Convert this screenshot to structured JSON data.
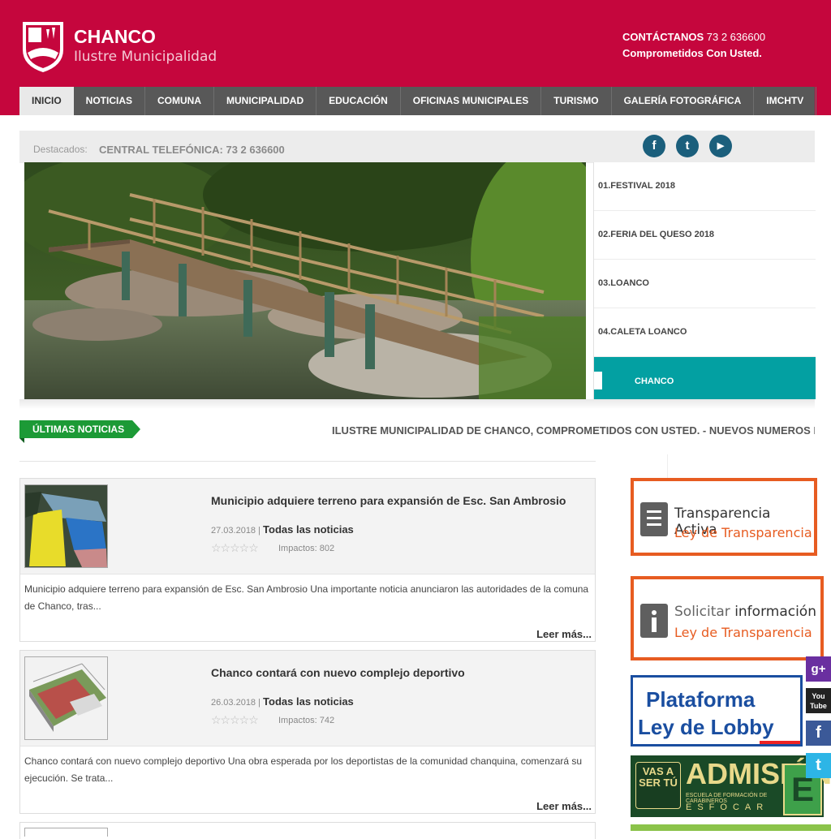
{
  "brand": {
    "title": "CHANCO",
    "subtitle": "Ilustre Municipalidad"
  },
  "contact": {
    "label": "CONTÁCTANOS",
    "phone": "73 2 636600",
    "tagline": "Comprometidos Con Usted."
  },
  "nav": {
    "items": [
      "INICIO",
      "NOTICIAS",
      "COMUNA",
      "MUNICIPALIDAD",
      "EDUCACIÓN",
      "OFICINAS MUNICIPALES",
      "TURISMO",
      "GALERÍA FOTOGRÁFICA",
      "IMCHTV"
    ]
  },
  "featured": {
    "label": "Destacados:",
    "text": "CENTRAL TELEFÓNICA: 73 2 636600"
  },
  "social": {
    "facebook": "f",
    "twitter": "t",
    "youtube": "▶"
  },
  "slider": {
    "items": [
      "01.FESTIVAL 2018",
      "02.FERIA DEL QUESO 2018",
      "03.LOANCO",
      "04.CALETA LOANCO",
      "CHANCO"
    ]
  },
  "news_tag": "ÚLTIMAS NOTICIAS",
  "ticker": "ILUSTRE MUNICIPALIDAD DE CHANCO, COMPROMETIDOS CON USTED. - NUEVOS NUMEROS DE ATENCI",
  "articles": [
    {
      "title": "Municipio adquiere terreno para expansión de Esc. San Ambrosio",
      "date": "27.03.2018",
      "category": "Todas las noticias",
      "stars": "☆☆☆☆☆",
      "hits": "Impactos: 802",
      "excerpt": "Municipio adquiere terreno para expansión de Esc. San Ambrosio Una importante noticia anunciaron las autoridades de la comuna de Chanco, tras...",
      "more": "Leer más..."
    },
    {
      "title": "Chanco contará con nuevo complejo deportivo",
      "date": "26.03.2018",
      "category": "Todas las noticias",
      "stars": "☆☆☆☆☆",
      "hits": "Impactos: 742",
      "excerpt": "Chanco contará con nuevo complejo deportivo Una obra esperada por los deportistas de la comunidad chanquina, comenzará su ejecución. Se trata...",
      "more": "Leer más..."
    }
  ],
  "banners": {
    "transparencia": {
      "line1": "Transparencia Activa",
      "line2": "Ley de Transparencia"
    },
    "solicitar": {
      "line1_a": "Solicitar",
      "line1_b": "información",
      "line2": "Ley de Transparencia"
    },
    "lobby": {
      "line1": "Plataforma",
      "line2": "Ley de Lobby"
    },
    "admision": {
      "title": "ADMISIÓN",
      "sub": "ESCUELA DE FORMACIÓN DE CARABINEROS",
      "esfocar": "ESFOCAR",
      "badge": "VAS A SER TÚ",
      "letter": "E"
    }
  },
  "float_social": {
    "gplus": "g+",
    "youtube": "You Tube",
    "facebook": "f",
    "twitter": "t"
  },
  "colors": {
    "brand_red": "#c5063d",
    "nav_gray": "#585858",
    "teal": "#03a0a2",
    "green": "#1c9a36",
    "orange": "#e75c21",
    "lobby_blue": "#1a4ea0"
  }
}
